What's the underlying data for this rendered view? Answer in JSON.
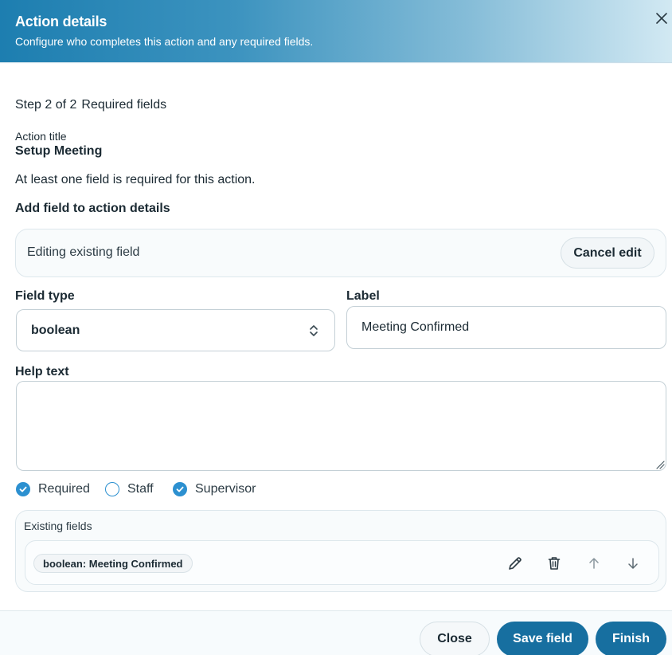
{
  "header": {
    "title": "Action details",
    "subtitle": "Configure who completes this action and any required fields."
  },
  "step": {
    "counter": "Step 2 of 2",
    "name": "Required fields"
  },
  "action": {
    "title_label": "Action title",
    "title_value": "Setup Meeting"
  },
  "notice": "At least one field is required for this action.",
  "add_field_heading": "Add field to action details",
  "edit_banner": {
    "text": "Editing existing field",
    "cancel_label": "Cancel edit"
  },
  "form": {
    "field_type_label": "Field type",
    "field_type_value": "boolean",
    "label_label": "Label",
    "label_value": "Meeting Confirmed",
    "help_text_label": "Help text",
    "help_text_value": ""
  },
  "options": [
    {
      "label": "Required",
      "checked": true
    },
    {
      "label": "Staff",
      "checked": false
    },
    {
      "label": "Supervisor",
      "checked": true
    }
  ],
  "existing": {
    "heading": "Existing fields",
    "items": [
      {
        "chip": "boolean: Meeting Confirmed",
        "icons": [
          "pencil-icon",
          "trash-icon",
          "arrow-up-icon",
          "arrow-down-icon"
        ]
      }
    ]
  },
  "footer": {
    "close_label": "Close",
    "save_label": "Save field",
    "finish_label": "Finish"
  },
  "colors": {
    "accent": "#2c90d0",
    "primary_button": "#176fa0",
    "header_gradient_start": "#1d7eb0",
    "header_gradient_end": "#d2e9f3"
  }
}
